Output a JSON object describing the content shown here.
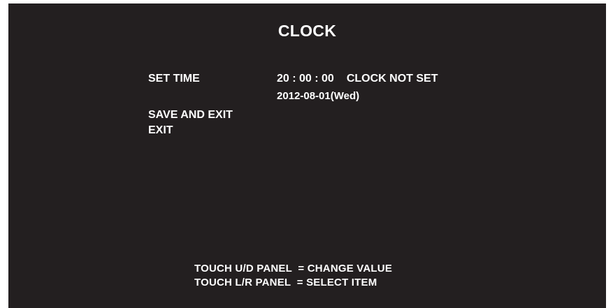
{
  "screen": {
    "title": "CLOCK",
    "set_time": {
      "label": "SET TIME",
      "time": "20 : 00 : 00",
      "status": "CLOCK NOT SET",
      "date": "2012-08-01(Wed)"
    },
    "menu": {
      "save_and_exit": "SAVE AND EXIT",
      "exit": "EXIT"
    },
    "instructions": [
      "TOUCH U/D PANEL  = CHANGE VALUE",
      "TOUCH L/R PANEL  = SELECT ITEM"
    ]
  }
}
